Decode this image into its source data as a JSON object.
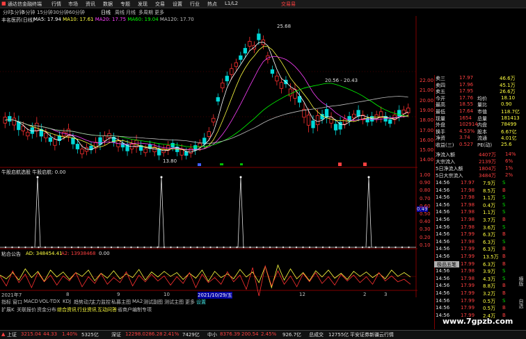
{
  "app": {
    "title": "通达信金融终端",
    "menus": [
      "行情",
      "市场",
      "资讯",
      "数据",
      "专题",
      "发现",
      "交易",
      "设置",
      "行业",
      "热点",
      "L1/L2"
    ],
    "right_label": "交易易"
  },
  "periods": [
    "分时",
    "1分钟",
    "5分钟",
    "15分钟",
    "30分钟",
    "60分钟",
    "日线",
    "周线",
    "月线",
    "多周期",
    "更多"
  ],
  "main_chart": {
    "stock_label": "丰名医药(日线)",
    "ma_labels": [
      {
        "name": "MA5: 17.94",
        "color": "#ffffff"
      },
      {
        "name": "MA10: 17.61",
        "color": "#ffff40"
      },
      {
        "name": "MA20: 17.75",
        "color": "#ff40ff"
      },
      {
        "name": "MA60: 19.04",
        "color": "#00ff00"
      },
      {
        "name": "MA120: 17.70",
        "color": "#c0c0c0"
      }
    ],
    "high_label": "25.68",
    "low_label": "13.80",
    "range_label": "20.56 - 20.43",
    "y_ticks": [
      "22.00",
      "21.00",
      "20.00",
      "19.00",
      "18.00",
      "17.00",
      "16.00",
      "15.00",
      "14.00"
    ]
  },
  "indicator1": {
    "title": "牛股启航选股 牛股启航: 0.00",
    "value_tag": "0.49",
    "y_ticks": [
      "1.00",
      "0.90",
      "0.80",
      "0.70",
      "0.60",
      "0.50",
      "0.40",
      "0.30",
      "0.20",
      "0.10"
    ]
  },
  "indicator2": {
    "title": "粘合公告",
    "ad_label": "AD: 348454.41",
    "a2_label": "A2: 13938468",
    "tail": "0.00"
  },
  "x_axis": {
    "dates": [
      "2021年7",
      "8",
      "9",
      "10",
      "2021/10/29/五",
      "12",
      "2",
      "3"
    ]
  },
  "func_tabs": [
    "指标",
    "窗口",
    "MACD",
    "VOL-TDX",
    "KDJ",
    "趋势动力",
    "主力监控",
    "私募主图",
    "MA2",
    "测试副图",
    "测试主图",
    "更多",
    "设置"
  ],
  "sub_tabs": [
    "扩展K",
    "关联报价",
    "资金分布",
    "综合资讯",
    "行业资讯",
    "互动问答",
    "省商户编制专项"
  ],
  "quote": {
    "rows": [
      {
        "label": "卖三",
        "price": "17.97",
        "vol": "46.6万"
      },
      {
        "label": "卖四",
        "price": "17.96",
        "vol": "45.1万"
      },
      {
        "label": "卖五",
        "price": "17.95",
        "vol": "26.6万"
      },
      {
        "label": "今开",
        "price": "17.76",
        "label2": "均价",
        "val2": "18.10"
      },
      {
        "label": "最高",
        "price": "18.55",
        "label2": "量比",
        "val2": "0.90"
      },
      {
        "label": "最低",
        "price": "17.64",
        "label2": "市值",
        "val2": "118.7亿"
      },
      {
        "label": "现量",
        "price": "1654",
        "label2": "总量",
        "val2": "181413"
      },
      {
        "label": "外盘",
        "price": "102914",
        "label2": "内盘",
        "val2": "78499"
      },
      {
        "label": "换手",
        "price": "4.53%",
        "label2": "股本",
        "val2": "6.67亿"
      },
      {
        "label": "净资",
        "price": "3.74",
        "label2": "流通",
        "val2": "4.01亿"
      },
      {
        "label": "收益(三)",
        "price": "0.527",
        "label2": "PE(动)",
        "val2": "25.6"
      }
    ],
    "flows": [
      {
        "label": "净流入额",
        "val": "4407万",
        "pct": "14%"
      },
      {
        "label": "大宗流入",
        "val": "2139万",
        "pct": "6%"
      },
      {
        "label": "5日净流入额",
        "val": "1804万",
        "pct": "1%"
      },
      {
        "label": "5日大宗流入",
        "val": "3484万",
        "pct": "2%"
      }
    ],
    "trades": [
      {
        "t": "14:56",
        "p": "17.97",
        "v": "7.9万",
        "d": "S"
      },
      {
        "t": "14:56",
        "p": "17.98",
        "v": "8.5万",
        "d": "B"
      },
      {
        "t": "14:56",
        "p": "17.98",
        "v": "1.1万",
        "d": "S"
      },
      {
        "t": "14:56",
        "p": "17.98",
        "v": "0.4万",
        "d": "S"
      },
      {
        "t": "14:56",
        "p": "17.98",
        "v": "1.1万",
        "d": "S"
      },
      {
        "t": "14:56",
        "p": "17.98",
        "v": "3.7万",
        "d": "B"
      },
      {
        "t": "14:56",
        "p": "17.98",
        "v": "3.6万",
        "d": "S"
      },
      {
        "t": "14:56",
        "p": "17.99",
        "v": "6.3万",
        "d": "B"
      },
      {
        "t": "14:56",
        "p": "17.98",
        "v": "6.3万",
        "d": "S"
      },
      {
        "t": "14:56",
        "p": "17.99",
        "v": "6.3万",
        "d": "B"
      },
      {
        "t": "14:56",
        "p": "17.99",
        "v": "13.5万",
        "d": "B"
      },
      {
        "t": "14:56",
        "p": "17.99",
        "v": "6.3万",
        "d": "B"
      },
      {
        "t": "14:56",
        "p": "17.98",
        "v": "3.9万",
        "d": "S"
      },
      {
        "t": "14:56",
        "p": "17.98",
        "v": "4.3万",
        "d": "S"
      },
      {
        "t": "14:56",
        "p": "17.99",
        "v": "8.8万",
        "d": "B"
      },
      {
        "t": "14:56",
        "p": "17.99",
        "v": "3.2万",
        "d": "B"
      },
      {
        "t": "14:56",
        "p": "17.99",
        "v": "0.5万",
        "d": "S"
      },
      {
        "t": "14:56",
        "p": "17.99",
        "v": "0.5万",
        "d": "B"
      },
      {
        "t": "14:56",
        "p": "17.99",
        "v": "2.4万",
        "d": "B"
      }
    ],
    "popup": "极品五笔"
  },
  "status": {
    "items": [
      {
        "name": "上证",
        "val": "3215.04",
        "chg": "44.33",
        "pct": "1.40%",
        "amt": "5325亿",
        "color": "#ff4040"
      },
      {
        "name": "深证",
        "val": "12298.0",
        "chg": "286.28",
        "pct": "2.41%",
        "amt": "7429亿",
        "color": "#ff4040"
      },
      {
        "name": "中小",
        "val": "8376.39",
        "chg": "200.54",
        "pct": "2.45%",
        "amt": "926.7亿",
        "color": "#ff4040"
      },
      {
        "name": "总成交",
        "val": "12755亿",
        "chg": "",
        "pct": "",
        "amt": "",
        "color": "#c0c0c0"
      }
    ],
    "right": "平安证券新疆云行情",
    "watermark": "www.7gpzb.com",
    "side_tabs": [
      "横版",
      "自选"
    ]
  }
}
